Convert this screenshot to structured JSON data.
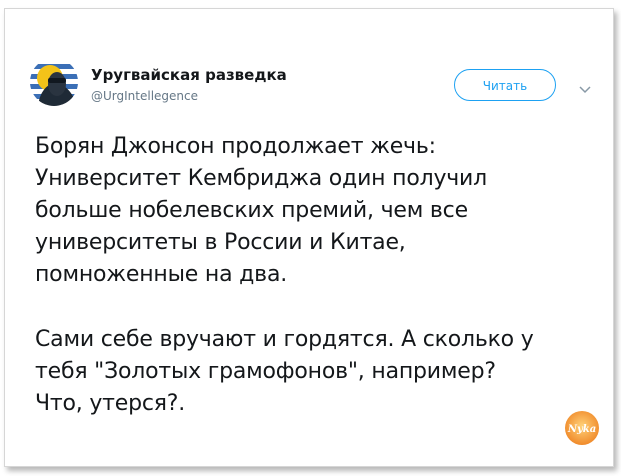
{
  "tweet": {
    "author": {
      "name": "Уругвайская разведка",
      "handle": "@UrgIntellegence"
    },
    "follow_label": "Читать",
    "lines_par1": [
      "Борян Джонсон продолжает жечь:",
      "Университет Кембриджа один получил",
      "больше нобелевских премий, чем все",
      "университеты в России и Китае,",
      "помноженные на два."
    ],
    "lines_par2": [
      "Сами себе вручают и гордятся. А сколько у",
      "тебя \"Золотых грамофонов\", например?",
      "Что, утерся?."
    ]
  },
  "watermark": {
    "text": "Nyka"
  },
  "colors": {
    "accent": "#1da1f2",
    "text": "#14171a",
    "muted": "#657786",
    "watermark": "#f4a23c"
  },
  "icons": {
    "follow_menu": "chevron-down-icon",
    "avatar": "uruguay-sun-flag-avatar"
  }
}
